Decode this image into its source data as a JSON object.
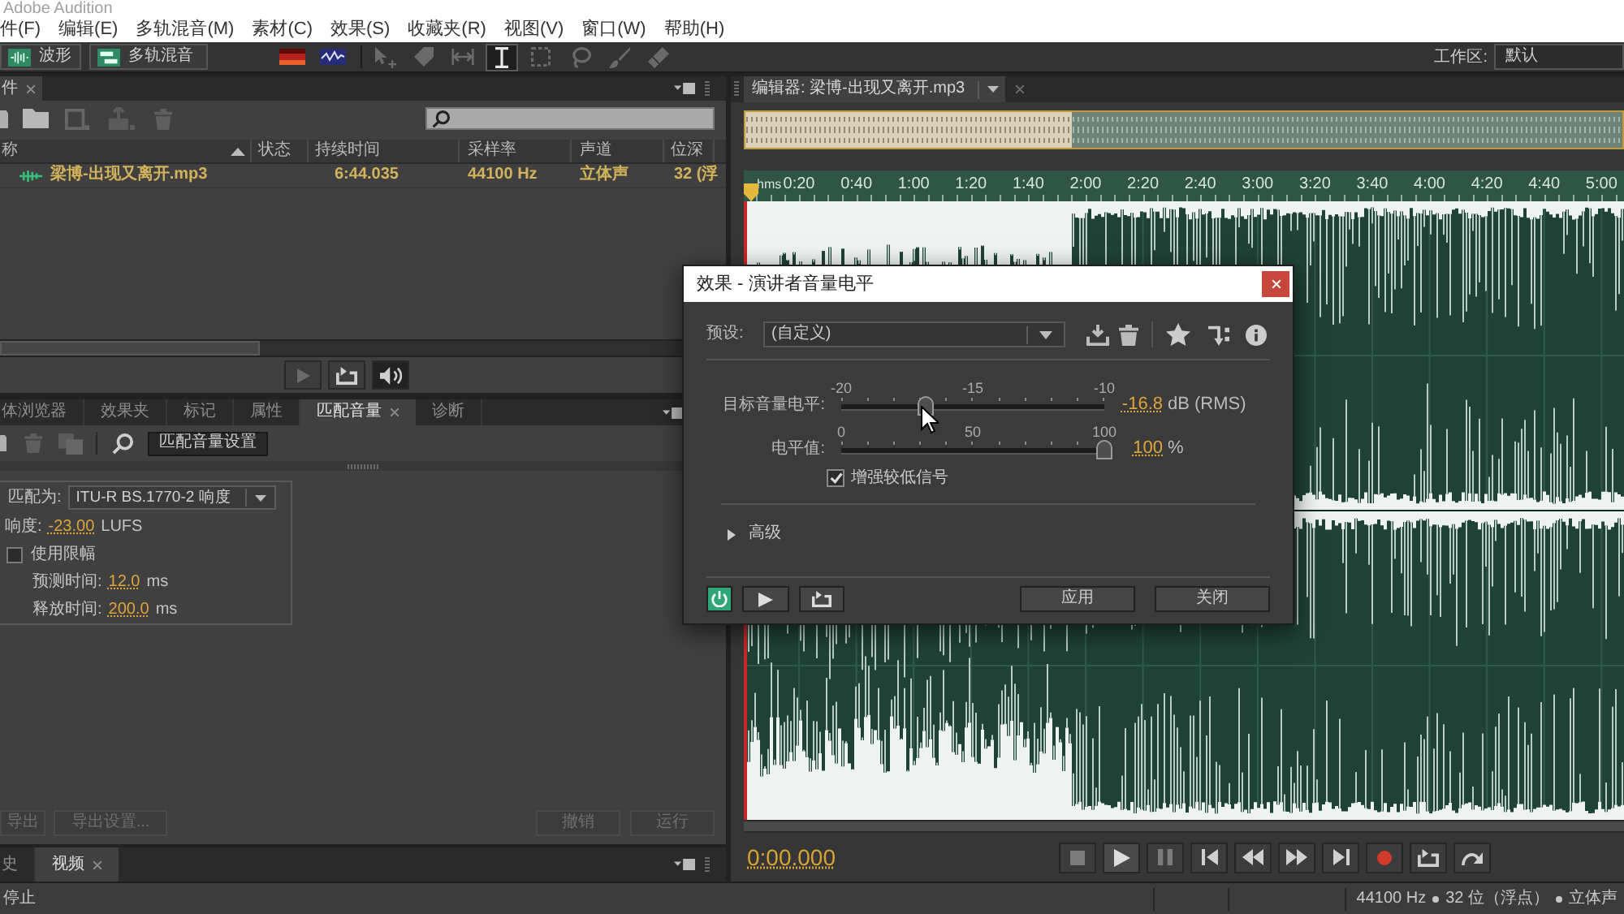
{
  "window": {
    "title": "Adobe Audition"
  },
  "menu": [
    "件(F)",
    "编辑(E)",
    "多轨混音(M)",
    "素材(C)",
    "效果(S)",
    "收藏夹(R)",
    "视图(V)",
    "窗口(W)",
    "帮助(H)"
  ],
  "toolbar": {
    "views": [
      "波形",
      "多轨混音"
    ],
    "tools": [
      {
        "selected": false
      },
      {
        "selected": false
      },
      {
        "selected": false
      },
      {
        "selected": true
      },
      {
        "selected": false
      },
      {
        "selected": false
      },
      {
        "selected": false
      },
      {
        "selected": false
      }
    ],
    "workspace": {
      "label": "工作区:",
      "value": "默认"
    }
  },
  "files_panel": {
    "tab": "件",
    "columns": [
      "称",
      "状态",
      "持续时间",
      "采样率",
      "声道",
      "位深"
    ],
    "rows": [
      {
        "name": "梁博-出现又离开.mp3",
        "duration": "6:44.035",
        "sample_rate": "44100 Hz",
        "channels": "立体声",
        "bit_depth": "32 (浮"
      }
    ]
  },
  "match_panel": {
    "tabs": [
      {
        "label": "体浏览器",
        "selected": false
      },
      {
        "label": "效果夹",
        "selected": false
      },
      {
        "label": "标记",
        "selected": false
      },
      {
        "label": "属性",
        "selected": false
      },
      {
        "label": "匹配音量",
        "selected": true
      },
      {
        "label": "诊断",
        "selected": false
      }
    ],
    "settings_button": "匹配音量设置",
    "match_to": {
      "label": "匹配为:",
      "value": "ITU-R BS.1770-2 响度"
    },
    "loudness": {
      "label": "响度:",
      "value": "-23.00",
      "unit": "LUFS"
    },
    "limiting": {
      "label": "使用限幅",
      "checked": false
    },
    "lookahead": {
      "label": "预测时间:",
      "value": "12.0",
      "unit": "ms"
    },
    "release": {
      "label": "释放时间:",
      "value": "200.0",
      "unit": "ms"
    },
    "buttons": [
      {
        "label": "导出",
        "disabled": true
      },
      {
        "label": "导出设置...",
        "disabled": true
      },
      {
        "label": "撤销",
        "disabled": true
      },
      {
        "label": "运行",
        "disabled": true
      }
    ]
  },
  "history_panel": {
    "tabs": [
      {
        "label": "史",
        "selected": false
      },
      {
        "label": "视频",
        "selected": true
      }
    ]
  },
  "editor": {
    "tab": "编辑器: 梁博-出现又离开.mp3",
    "ruler": {
      "unit": "hms",
      "labels": [
        "0:20",
        "0:40",
        "1:00",
        "1:20",
        "1:40",
        "2:00",
        "2:20",
        "2:40",
        "3:00",
        "3:20",
        "3:40",
        "4:00",
        "4:20",
        "4:40",
        "5:00"
      ]
    },
    "time": "0:00.000"
  },
  "dialog": {
    "title": "效果 - 演讲者音量电平",
    "preset": {
      "label": "预设:",
      "value": "(自定义)"
    },
    "sliders": [
      {
        "label": "目标音量电平:",
        "ticks": [
          "-20",
          "-15",
          "-10"
        ],
        "level": 0.32,
        "value": "-16.8",
        "unit": "dB (RMS)"
      },
      {
        "label": "电平值:",
        "ticks": [
          "0",
          "50",
          "100"
        ],
        "level": 1,
        "value": "100",
        "unit": "%"
      }
    ],
    "boost": {
      "label": "增强较低信号",
      "checked": true
    },
    "advanced": {
      "label": "高级",
      "expanded": false
    },
    "power": {
      "on": true
    },
    "buttons": [
      "应用",
      "关闭"
    ]
  },
  "status_bar": {
    "state": "停止",
    "info": [
      "44100 Hz",
      "32 位（浮点）",
      "立体声"
    ]
  }
}
